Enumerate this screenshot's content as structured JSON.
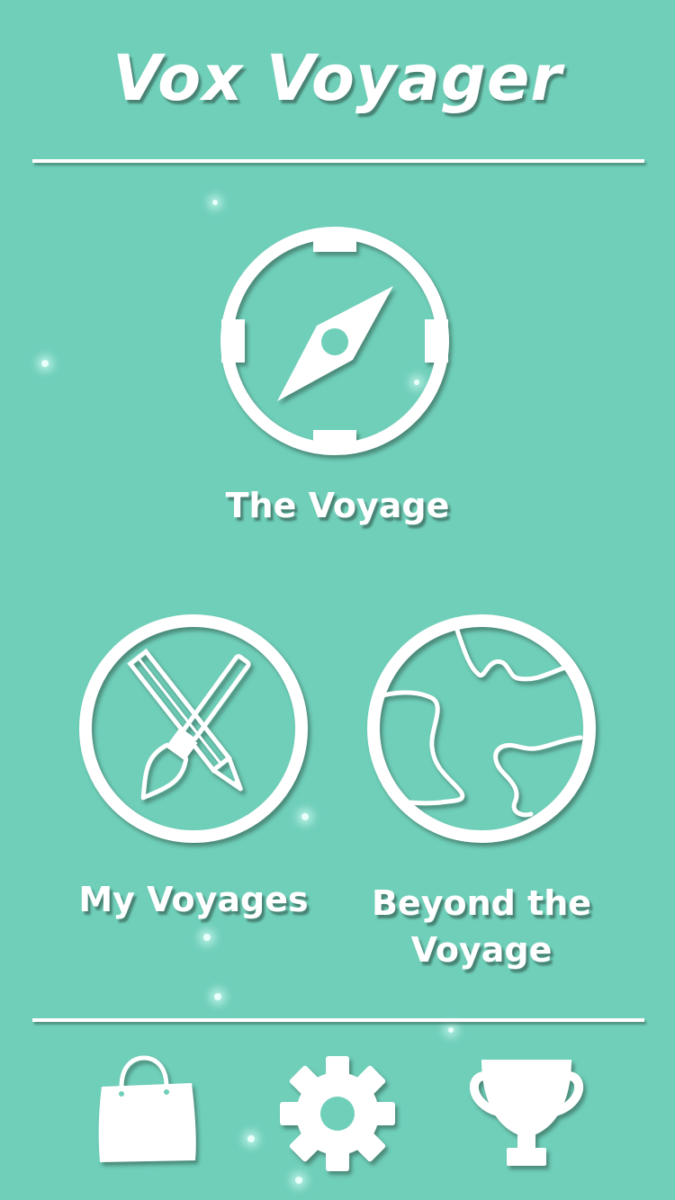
{
  "app": {
    "title": "Vox Voyager"
  },
  "menu": {
    "the_voyage": {
      "label": "The Voyage",
      "icon": "compass-icon"
    },
    "my_voyages": {
      "label": "My Voyages",
      "icon": "pencil-brush-icon"
    },
    "beyond": {
      "label": "Beyond the Voyage",
      "icon": "globe-icon"
    }
  },
  "toolbar": {
    "shop": {
      "icon": "shopping-bag-icon"
    },
    "settings": {
      "icon": "gear-icon"
    },
    "achievements": {
      "icon": "trophy-icon"
    }
  },
  "colors": {
    "background": "#6fcfb9",
    "foreground": "#ffffff",
    "shadow": "#284640"
  }
}
